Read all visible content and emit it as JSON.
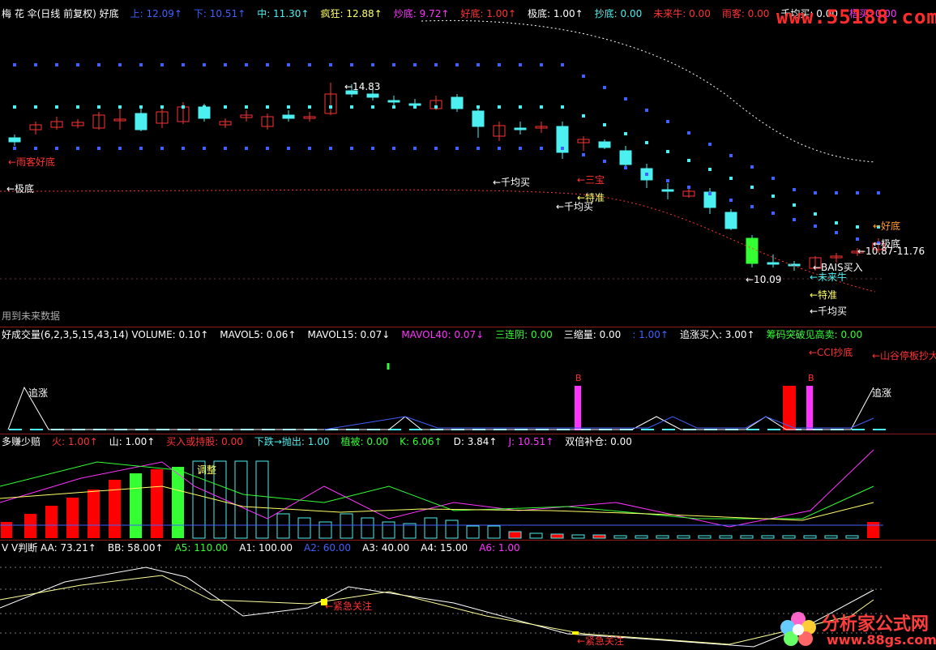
{
  "colors": {
    "red": "#ff3333",
    "cyan": "#4cf0f0",
    "yellow": "#ffff66",
    "magenta": "#ff33ff",
    "green": "#33ff33",
    "white": "#ffffff",
    "blue": "#4060ff",
    "orange": "#ff9933"
  },
  "header1": [
    {
      "text": "梅 花 伞(日线 前复权) 好底",
      "color": "white"
    },
    {
      "text": "上: 12.09↑",
      "color": "blue"
    },
    {
      "text": "下: 10.51↑",
      "color": "blue"
    },
    {
      "text": "中: 11.30↑",
      "color": "cyan"
    },
    {
      "text": "疯狂: 12.88↑",
      "color": "yellow"
    },
    {
      "text": "炒底: 9.72↑",
      "color": "magenta"
    },
    {
      "text": "好底: 1.00↑",
      "color": "red"
    },
    {
      "text": "极底: 1.00↑",
      "color": "white"
    },
    {
      "text": "抄底: 0.00",
      "color": "cyan"
    },
    {
      "text": "未来牛: 0.00",
      "color": "red"
    },
    {
      "text": "雨客: 0.00",
      "color": "red"
    },
    {
      "text": "千均买: 0.00",
      "color": "white"
    },
    {
      "text": "梧买: 0.00",
      "color": "magenta"
    }
  ],
  "watermark_top": "www.55188.com",
  "main_labels": {
    "high": "←14.83",
    "low1": "←10.09",
    "range": "←10.87-11.76",
    "yukehaodi": "←雨客好底",
    "jidi_left": "←极底",
    "qianjunmai1": "←千均买",
    "sanbao": "←三宝",
    "tezhun1": "←特准",
    "qianjunmai2": "←千均买",
    "haodi_right": "←好底",
    "jidi_right": "←极底",
    "bais": "←BAIS买入",
    "weilainiu": "←未来牛",
    "tezhun2": "←特准",
    "qianjunmai3": "←千均买",
    "future_data": "用到未来数据"
  },
  "header2": [
    {
      "text": "好成交量(6,2,3,5,15,43,14) VOLUME: 0.10↑",
      "color": "white"
    },
    {
      "text": "MAVOL5: 0.06↑",
      "color": "white"
    },
    {
      "text": "MAVOL15: 0.07↓",
      "color": "white"
    },
    {
      "text": "MAVOL40: 0.07↓",
      "color": "magenta"
    },
    {
      "text": "三连阴: 0.00",
      "color": "green"
    },
    {
      "text": "三缩量: 0.00",
      "color": "white"
    },
    {
      "text": ": 1.00↑",
      "color": "blue"
    },
    {
      "text": "追涨买入: 3.00↑",
      "color": "white"
    },
    {
      "text": "筹码突破见高卖: 0.00",
      "color": "green"
    }
  ],
  "vol_labels": {
    "cci": "←CCI抄底",
    "shangu": "←山谷停板抄大",
    "zhuizhang1": "追涨",
    "zhuizhang2": "追涨",
    "b1": "B",
    "b2": "B"
  },
  "header3": [
    {
      "text": "多赚少赔",
      "color": "white"
    },
    {
      "text": "火: 1.00↑",
      "color": "red"
    },
    {
      "text": "山: 1.00↑",
      "color": "white"
    },
    {
      "text": "买入或持股: 0.00",
      "color": "red"
    },
    {
      "text": "下跌→抛出: 1.00",
      "color": "cyan"
    },
    {
      "text": "植被: 0.00",
      "color": "green"
    },
    {
      "text": "K: 6.06↑",
      "color": "green"
    },
    {
      "text": "D: 3.84↑",
      "color": "white"
    },
    {
      "text": "J: 10.51↑",
      "color": "magenta"
    },
    {
      "text": "双倍补仓: 0.00",
      "color": "white"
    }
  ],
  "kd_labels": {
    "tiaozheng": "调整"
  },
  "header4": [
    {
      "text": "V V判断 AA: 73.21↑",
      "color": "white"
    },
    {
      "text": "BB: 58.00↑",
      "color": "white"
    },
    {
      "text": "A5: 110.00",
      "color": "green"
    },
    {
      "text": "A1: 100.00",
      "color": "white"
    },
    {
      "text": "A2: 60.00",
      "color": "blue"
    },
    {
      "text": "A3: 40.00",
      "color": "white"
    },
    {
      "text": "A4: 15.00",
      "color": "white"
    },
    {
      "text": "A6: 1.00",
      "color": "magenta"
    }
  ],
  "vv_labels": {
    "focus1": "←紧急关注",
    "focus2": "←紧急关注"
  },
  "logo": {
    "title": "分析家公式网",
    "url": "www.88gs.com"
  }
}
